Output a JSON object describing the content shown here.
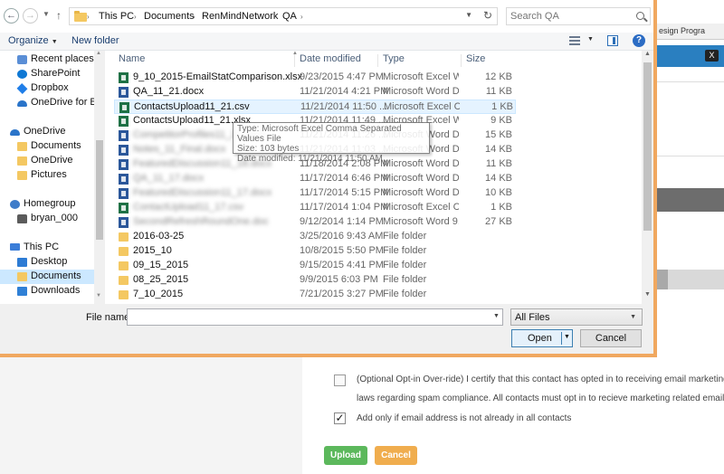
{
  "background": {
    "tab_label": "esign Progra",
    "close_label": "X",
    "optin_line1": "(Optional Opt-in Over-ride) I certify that this contact has opted in to receiving email marketing mess",
    "optin_line2": "laws regarding spam compliance. All contacts must opt in to recieve marketing related emails. If yo",
    "add_only_label": "Add only if email address is not already in all contacts",
    "add_only_checked": true,
    "upload_button": "Upload",
    "cancel_button": "Cancel",
    "upload_color": "#5cb85c",
    "cancel_color": "#f0ad4e"
  },
  "dialog": {
    "breadcrumb": [
      "This PC",
      "Documents",
      "RenMindNetwork",
      "QA"
    ],
    "search": {
      "placeholder": "Search QA"
    },
    "toolbar": {
      "organize": "Organize",
      "new_folder": "New folder"
    },
    "nav": {
      "items": [
        {
          "label": "Recent places",
          "icon": "recent-places-icon"
        },
        {
          "label": "SharePoint",
          "icon": "sharepoint-icon"
        },
        {
          "label": "Dropbox",
          "icon": "dropbox-icon"
        },
        {
          "label": "OneDrive for Bus",
          "icon": "onedrive-business-icon"
        },
        {
          "label": "OneDrive",
          "icon": "onedrive-icon"
        },
        {
          "label": "Documents",
          "icon": "folder-icon"
        },
        {
          "label": "OneDrive",
          "icon": "folder-icon"
        },
        {
          "label": "Pictures",
          "icon": "folder-icon"
        },
        {
          "label": "Homegroup",
          "icon": "homegroup-icon"
        },
        {
          "label": "bryan_000",
          "icon": "user-icon"
        },
        {
          "label": "This PC",
          "icon": "this-pc-icon"
        },
        {
          "label": "Desktop",
          "icon": "desktop-icon"
        },
        {
          "label": "Documents",
          "icon": "documents-icon"
        },
        {
          "label": "Downloads",
          "icon": "downloads-icon"
        }
      ]
    },
    "columns": {
      "name": "Name",
      "date": "Date modified",
      "type": "Type",
      "size": "Size"
    },
    "files": [
      {
        "name": "9_10_2015-EmailStatComparison.xlsx",
        "date": "9/23/2015 4:47 PM",
        "type": "Microsoft Excel W...",
        "size": "12 KB",
        "icon": "excel",
        "blurred": false
      },
      {
        "name": "QA_11_21.docx",
        "date": "11/21/2014 4:21 PM",
        "type": "Microsoft Word D...",
        "size": "11 KB",
        "icon": "word",
        "blurred": false
      },
      {
        "name": "ContactsUpload11_21.csv",
        "date": "11/21/2014 11:50 ...",
        "type": "Microsoft Excel C...",
        "size": "1 KB",
        "icon": "excel",
        "blurred": false,
        "selected": true
      },
      {
        "name": "ContactsUpload11_21.xlsx",
        "date": "11/21/2014 11:49 ...",
        "type": "Microsoft Excel W...",
        "size": "9 KB",
        "icon": "excel",
        "blurred": false
      },
      {
        "name": "CompetitorProfiles11_21.docx",
        "date": "11/21/2014 11:26 ...",
        "type": "Microsoft Word D...",
        "size": "15 KB",
        "icon": "word",
        "blurred": true
      },
      {
        "name": "Notes_11_Final.docx",
        "date": "11/21/2014 11:03 ...",
        "type": "Microsoft Word D...",
        "size": "14 KB",
        "icon": "word",
        "blurred": true
      },
      {
        "name": "FeaturedDiscussion11_18.docx",
        "date": "11/18/2014 2:08 PM",
        "type": "Microsoft Word D...",
        "size": "11 KB",
        "icon": "word",
        "blurred": true
      },
      {
        "name": "QA_11_17.docx",
        "date": "11/17/2014 6:46 PM",
        "type": "Microsoft Word D...",
        "size": "14 KB",
        "icon": "word",
        "blurred": true
      },
      {
        "name": "FeaturedDiscussion11_17.docx",
        "date": "11/17/2014 5:15 PM",
        "type": "Microsoft Word D...",
        "size": "10 KB",
        "icon": "word",
        "blurred": true
      },
      {
        "name": "ContactUpload11_17.csv",
        "date": "11/17/2014 1:04 PM",
        "type": "Microsoft Excel C...",
        "size": "1 KB",
        "icon": "excel",
        "blurred": true
      },
      {
        "name": "SecondRefreshRoundOne.doc",
        "date": "9/12/2014 1:14 PM",
        "type": "Microsoft Word 9...",
        "size": "27 KB",
        "icon": "word",
        "blurred": true
      },
      {
        "name": "2016-03-25",
        "date": "3/25/2016 9:43 AM",
        "type": "File folder",
        "size": "",
        "icon": "folder",
        "blurred": false
      },
      {
        "name": "2015_10",
        "date": "10/8/2015 5:50 PM",
        "type": "File folder",
        "size": "",
        "icon": "folder",
        "blurred": false
      },
      {
        "name": "09_15_2015",
        "date": "9/15/2015 4:41 PM",
        "type": "File folder",
        "size": "",
        "icon": "folder",
        "blurred": false
      },
      {
        "name": "08_25_2015",
        "date": "9/9/2015 6:03 PM",
        "type": "File folder",
        "size": "",
        "icon": "folder",
        "blurred": false
      },
      {
        "name": "7_10_2015",
        "date": "7/21/2015 3:27 PM",
        "type": "File folder",
        "size": "",
        "icon": "folder",
        "blurred": false
      }
    ],
    "tooltip": {
      "type_line": "Type: Microsoft Excel Comma Separated Values File",
      "size_line": "Size: 103 bytes",
      "date_line": "Date modified: 11/21/2014 11:50 AM"
    },
    "file_name_label": "File name:",
    "file_name_value": "",
    "filter": "All Files",
    "open_button": "Open",
    "cancel_button": "Cancel",
    "border_color": "#f0a860"
  }
}
